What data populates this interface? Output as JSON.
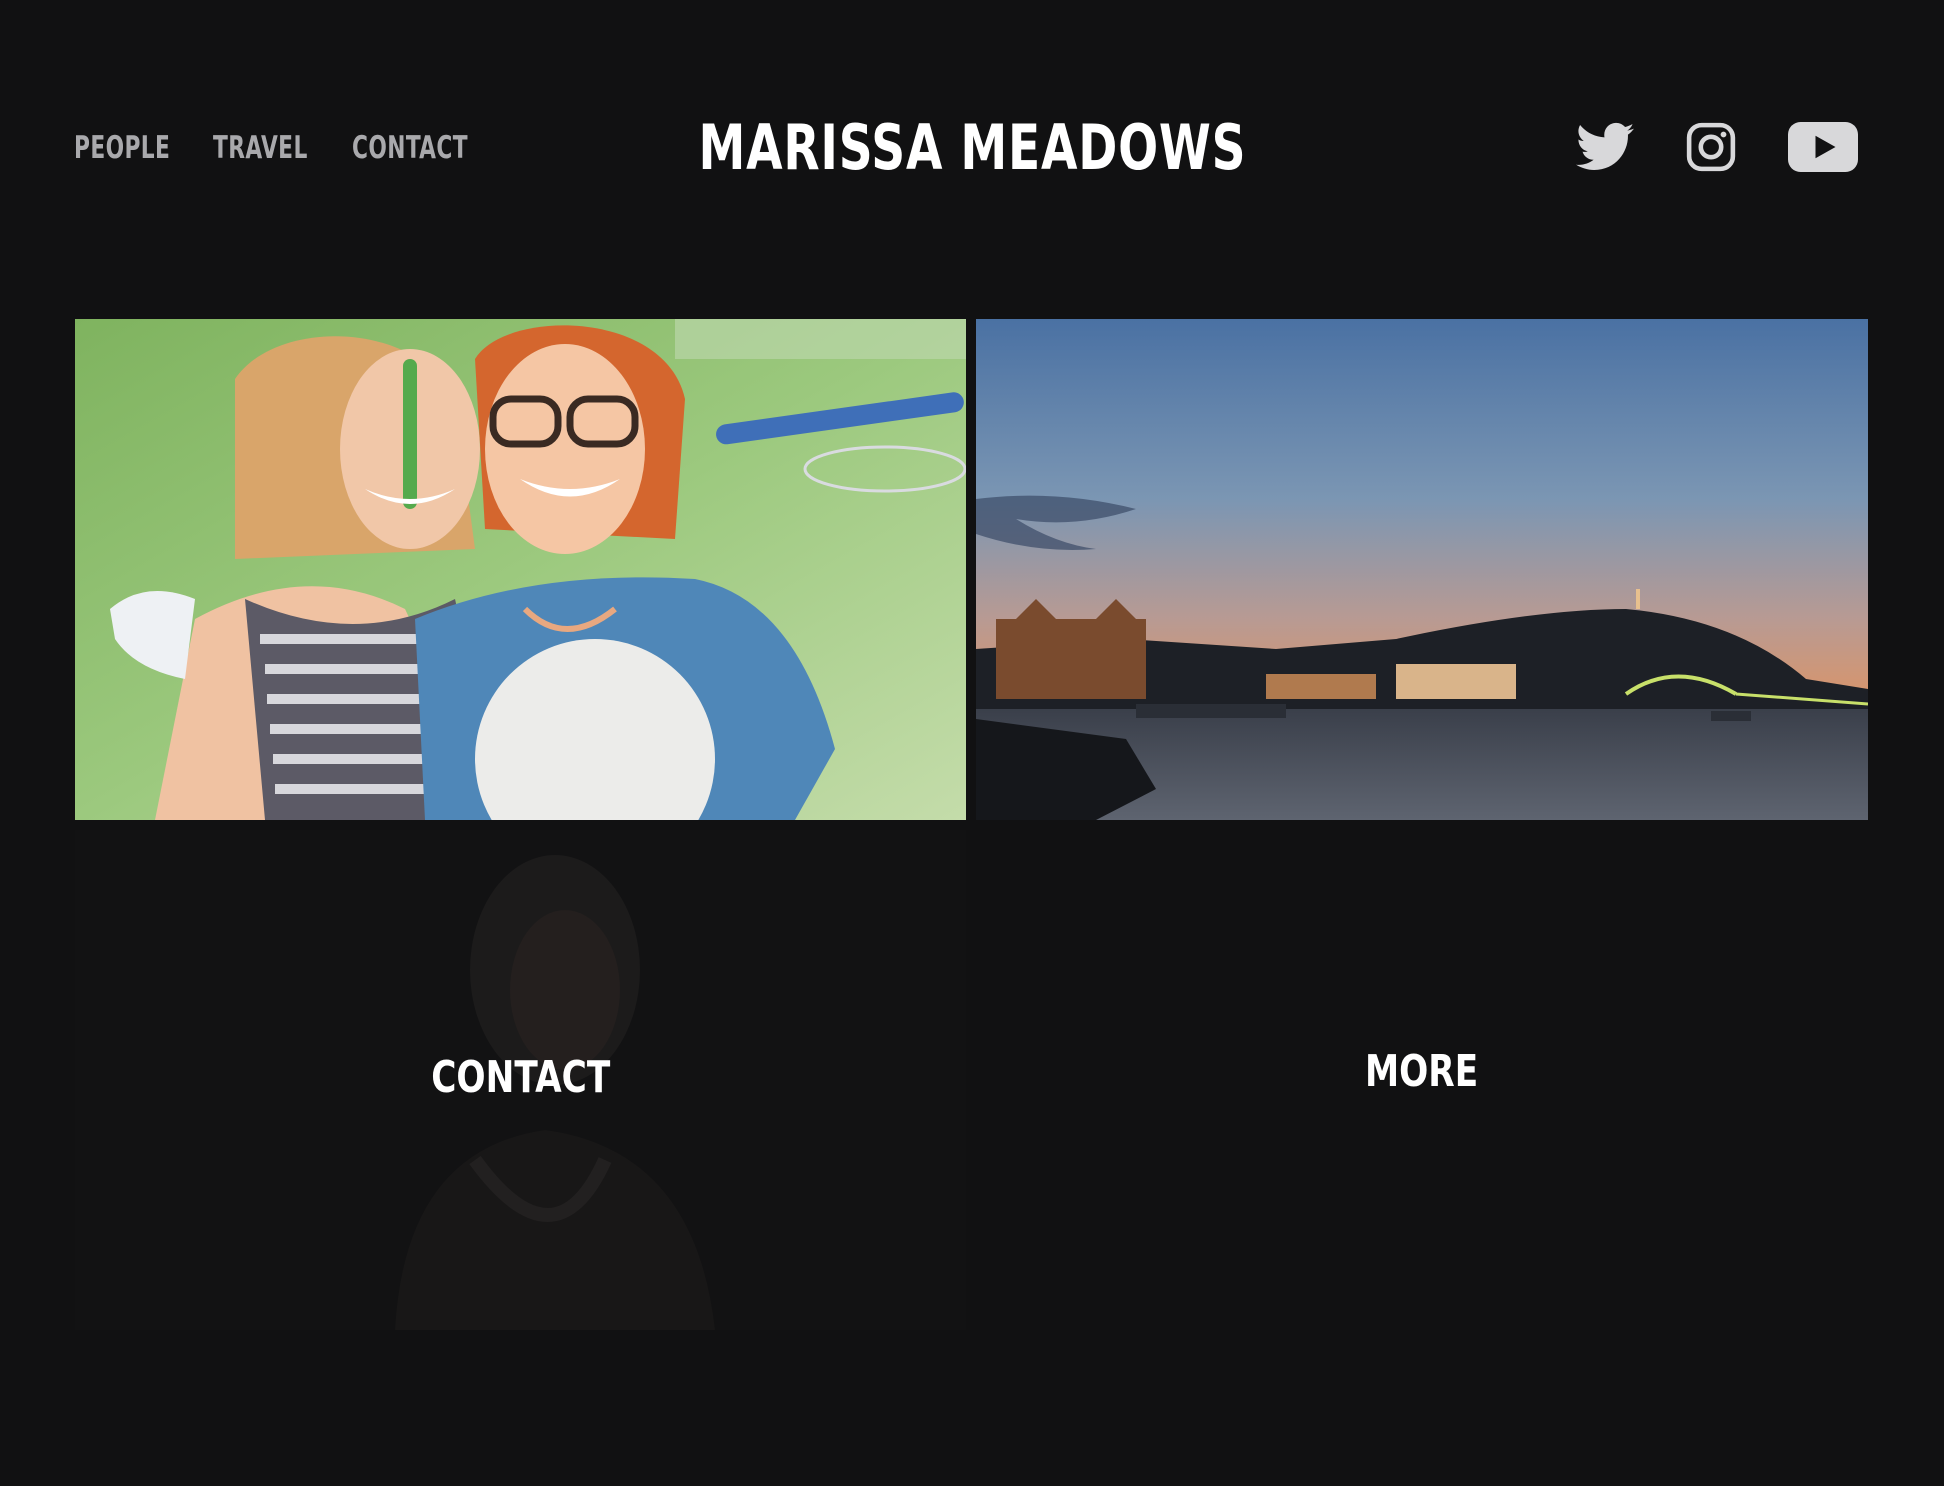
{
  "header": {
    "site_title": "MARISSA MEADOWS",
    "nav": [
      {
        "label": "PEOPLE"
      },
      {
        "label": "TRAVEL"
      },
      {
        "label": "CONTACT"
      }
    ],
    "social": [
      {
        "icon": "twitter-icon"
      },
      {
        "icon": "instagram-icon"
      },
      {
        "icon": "youtube-icon"
      }
    ]
  },
  "grid": {
    "tiles": [
      {
        "name": "people",
        "image": "two smiling women outdoors on grass",
        "label": ""
      },
      {
        "name": "travel",
        "image": "river at dusk with city lights and hill",
        "label": ""
      },
      {
        "name": "contact",
        "image": "dim portrait of a woman",
        "label": "CONTACT"
      },
      {
        "name": "more",
        "image": "",
        "label": "MORE"
      }
    ]
  },
  "colors": {
    "background": "#111112",
    "nav_text": "#a9a9ac",
    "title_text": "#ffffff"
  }
}
